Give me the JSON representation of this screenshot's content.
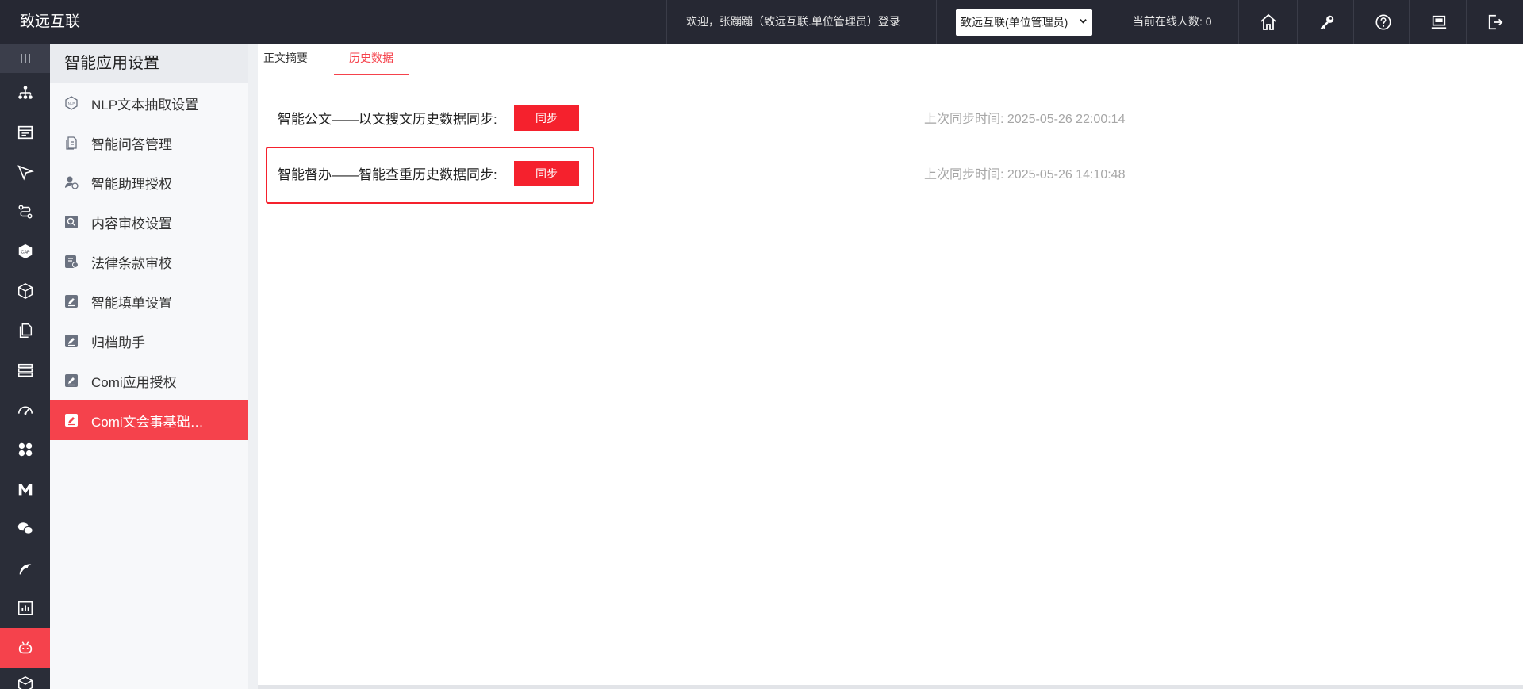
{
  "header": {
    "brand": "致远互联",
    "welcome": "欢迎，张蹦蹦（致远互联.单位管理员）登录",
    "unit_select": "致远互联(单位管理员)",
    "online_count": "当前在线人数: 0",
    "icons": [
      "home-icon",
      "key-icon",
      "help-icon",
      "monitor-icon",
      "logout-icon"
    ]
  },
  "rail": {
    "icons": [
      "menu-lines-icon",
      "org-chart-icon",
      "form-icon",
      "send-icon",
      "flow-icon",
      "cap-icon",
      "cube-icon",
      "docs-icon",
      "stack-icon",
      "gauge-icon",
      "apps-icon",
      "m-logo-icon",
      "chat-icon",
      "bird-icon",
      "report-icon",
      "robot-icon",
      "box-icon"
    ]
  },
  "submenu": {
    "title": "智能应用设置",
    "items": [
      {
        "label": "NLP文本抽取设置",
        "icon": "nlp-icon"
      },
      {
        "label": "智能问答管理",
        "icon": "qa-icon"
      },
      {
        "label": "智能助理授权",
        "icon": "user-auth-icon"
      },
      {
        "label": "内容审校设置",
        "icon": "search-doc-icon"
      },
      {
        "label": "法律条款审校",
        "icon": "law-icon"
      },
      {
        "label": "智能填单设置",
        "icon": "edit-icon"
      },
      {
        "label": "归档助手",
        "icon": "edit-icon"
      },
      {
        "label": "Comi应用授权",
        "icon": "edit-icon"
      },
      {
        "label": "Comi文会事基础…",
        "icon": "edit-icon",
        "active": true
      }
    ]
  },
  "tabs": [
    {
      "label": "正文摘要",
      "active": false
    },
    {
      "label": "历史数据",
      "active": true
    }
  ],
  "rows": [
    {
      "label": "智能公文——以文搜文历史数据同步:",
      "button": "同步",
      "last_sync": "上次同步时间: 2025-05-26 22:00:14"
    },
    {
      "label": "智能督办——智能查重历史数据同步:",
      "button": "同步",
      "last_sync": "上次同步时间: 2025-05-26 14:10:48"
    }
  ],
  "colors": {
    "accent": "#f5424c",
    "button": "#f5212d",
    "topbar": "#262833",
    "rail": "#2a2d38"
  }
}
